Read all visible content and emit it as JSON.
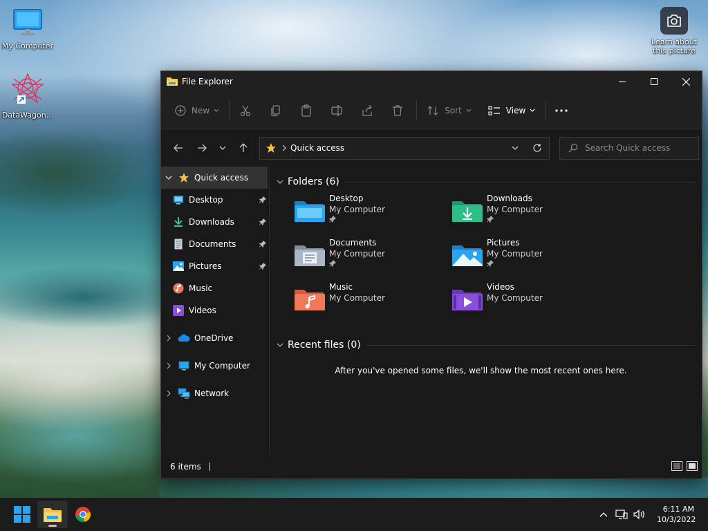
{
  "desktop": {
    "icons": [
      {
        "label": "My Computer"
      },
      {
        "label": "DataWagon..."
      }
    ],
    "spotlight": {
      "line1": "Learn about",
      "line2": "this picture"
    }
  },
  "window": {
    "title": "File Explorer",
    "toolbar": {
      "new_label": "New",
      "sort_label": "Sort",
      "view_label": "View"
    },
    "address": {
      "path": "Quick access"
    },
    "search": {
      "placeholder": "Search Quick access"
    },
    "sidebar": {
      "quick_access": "Quick access",
      "items": [
        {
          "label": "Desktop"
        },
        {
          "label": "Downloads"
        },
        {
          "label": "Documents"
        },
        {
          "label": "Pictures"
        },
        {
          "label": "Music"
        },
        {
          "label": "Videos"
        }
      ],
      "onedrive": "OneDrive",
      "my_computer": "My Computer",
      "network": "Network"
    },
    "content": {
      "folders_heading": "Folders (6)",
      "folders": [
        {
          "name": "Desktop",
          "location": "My Computer"
        },
        {
          "name": "Downloads",
          "location": "My Computer"
        },
        {
          "name": "Documents",
          "location": "My Computer"
        },
        {
          "name": "Pictures",
          "location": "My Computer"
        },
        {
          "name": "Music",
          "location": "My Computer"
        },
        {
          "name": "Videos",
          "location": "My Computer"
        }
      ],
      "recent_heading": "Recent files (0)",
      "recent_empty": "After you've opened some files, we'll show the most recent ones here."
    },
    "status": {
      "items": "6 items"
    }
  },
  "taskbar": {
    "clock": {
      "time": "6:11 AM",
      "date": "10/3/2022"
    }
  },
  "colors": {
    "window_bg": "#191919",
    "titlebar_bg": "#202020",
    "folder_accent": "#f6c344",
    "windows_blue": "#2aa3f0"
  }
}
